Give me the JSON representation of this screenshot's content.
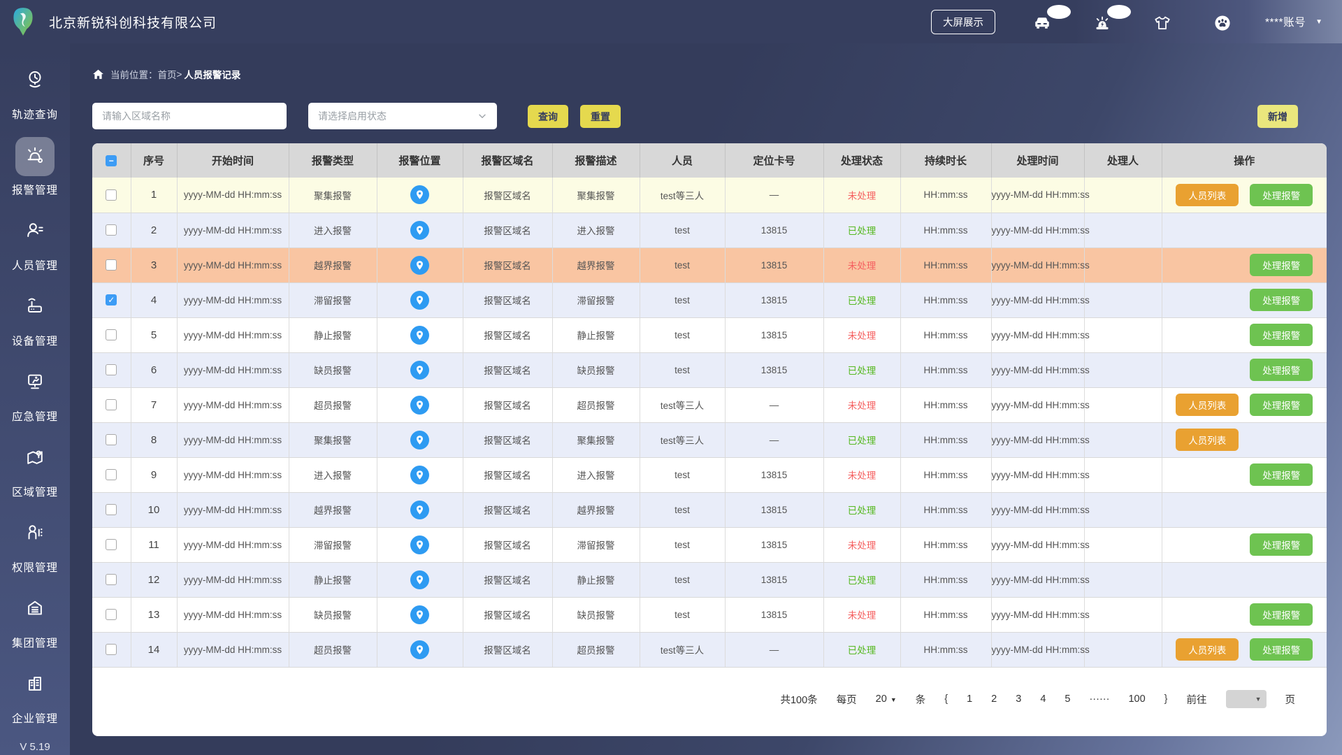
{
  "topbar": {
    "company": "北京新锐科创科技有限公司",
    "big_screen": "大屏展示",
    "account": "****账号",
    "icons": [
      {
        "name": "vehicle-icon",
        "badge": true
      },
      {
        "name": "alarm-light-icon",
        "badge": true
      },
      {
        "name": "tshirt-icon",
        "badge": false
      },
      {
        "name": "paw-icon",
        "badge": false
      }
    ]
  },
  "sidebar": {
    "items": [
      {
        "label": "轨迹查询",
        "icon": "track-icon",
        "active": false
      },
      {
        "label": "报警管理",
        "icon": "siren-icon",
        "active": true
      },
      {
        "label": "人员管理",
        "icon": "person-icon",
        "active": false
      },
      {
        "label": "设备管理",
        "icon": "device-icon",
        "active": false
      },
      {
        "label": "应急管理",
        "icon": "emergency-icon",
        "active": false
      },
      {
        "label": "区域管理",
        "icon": "area-icon",
        "active": false
      },
      {
        "label": "权限管理",
        "icon": "permission-icon",
        "active": false
      },
      {
        "label": "集团管理",
        "icon": "group-icon",
        "active": false
      },
      {
        "label": "企业管理",
        "icon": "enterprise-icon",
        "active": false
      }
    ],
    "version": "V 5.19"
  },
  "breadcrumb": {
    "prefix": "当前位置：",
    "home": "首页",
    "separator": ">",
    "current": "人员报警记录"
  },
  "filters": {
    "area_placeholder": "请输入区域名称",
    "status_placeholder": "请选择启用状态",
    "search": "查询",
    "reset": "重置",
    "add": "新增"
  },
  "table": {
    "columns": [
      "序号",
      "开始时间",
      "报警类型",
      "报警位置",
      "报警区域名",
      "报警描述",
      "人员",
      "定位卡号",
      "处理状态",
      "持续时长",
      "处理时间",
      "处理人",
      "操作"
    ],
    "action_labels": {
      "list": "人员列表",
      "handle": "处理报警"
    },
    "header_checkbox": "indeterminate",
    "rows": [
      {
        "index": "1",
        "start_time": "yyyy-MM-dd HH:mm:ss",
        "type": "聚集报警",
        "area": "报警区域名",
        "desc": "聚集报警",
        "person": "test等三人",
        "card": "—",
        "status": "未处理",
        "status_state": "pending",
        "duration": "HH:mm:ss",
        "handle_time": "yyyy-MM-dd HH:mm:ss",
        "handler": "",
        "checked": false,
        "bg": "highlight-yellow",
        "actions": [
          "list",
          "handle"
        ]
      },
      {
        "index": "2",
        "start_time": "yyyy-MM-dd HH:mm:ss",
        "type": "进入报警",
        "area": "报警区域名",
        "desc": "进入报警",
        "person": "test",
        "card": "13815",
        "status": "已处理",
        "status_state": "done",
        "duration": "HH:mm:ss",
        "handle_time": "yyyy-MM-dd HH:mm:ss",
        "handler": "",
        "checked": false,
        "bg": "stripe",
        "actions": []
      },
      {
        "index": "3",
        "start_time": "yyyy-MM-dd HH:mm:ss",
        "type": "越界报警",
        "area": "报警区域名",
        "desc": "越界报警",
        "person": "test",
        "card": "13815",
        "status": "未处理",
        "status_state": "pending",
        "duration": "HH:mm:ss",
        "handle_time": "yyyy-MM-dd HH:mm:ss",
        "handler": "",
        "checked": false,
        "bg": "highlight-orange",
        "actions": [
          "handle"
        ]
      },
      {
        "index": "4",
        "start_time": "yyyy-MM-dd HH:mm:ss",
        "type": "滞留报警",
        "area": "报警区域名",
        "desc": "滞留报警",
        "person": "test",
        "card": "13815",
        "status": "已处理",
        "status_state": "done",
        "duration": "HH:mm:ss",
        "handle_time": "yyyy-MM-dd HH:mm:ss",
        "handler": "",
        "checked": true,
        "bg": "stripe",
        "actions": [
          "handle"
        ]
      },
      {
        "index": "5",
        "start_time": "yyyy-MM-dd HH:mm:ss",
        "type": "静止报警",
        "area": "报警区域名",
        "desc": "静止报警",
        "person": "test",
        "card": "13815",
        "status": "未处理",
        "status_state": "pending",
        "duration": "HH:mm:ss",
        "handle_time": "yyyy-MM-dd HH:mm:ss",
        "handler": "",
        "checked": false,
        "bg": "plain",
        "actions": [
          "handle"
        ]
      },
      {
        "index": "6",
        "start_time": "yyyy-MM-dd HH:mm:ss",
        "type": "缺员报警",
        "area": "报警区域名",
        "desc": "缺员报警",
        "person": "test",
        "card": "13815",
        "status": "已处理",
        "status_state": "done",
        "duration": "HH:mm:ss",
        "handle_time": "yyyy-MM-dd HH:mm:ss",
        "handler": "",
        "checked": false,
        "bg": "stripe",
        "actions": [
          "handle"
        ]
      },
      {
        "index": "7",
        "start_time": "yyyy-MM-dd HH:mm:ss",
        "type": "超员报警",
        "area": "报警区域名",
        "desc": "超员报警",
        "person": "test等三人",
        "card": "—",
        "status": "未处理",
        "status_state": "pending",
        "duration": "HH:mm:ss",
        "handle_time": "yyyy-MM-dd HH:mm:ss",
        "handler": "",
        "checked": false,
        "bg": "plain",
        "actions": [
          "list",
          "handle"
        ]
      },
      {
        "index": "8",
        "start_time": "yyyy-MM-dd HH:mm:ss",
        "type": "聚集报警",
        "area": "报警区域名",
        "desc": "聚集报警",
        "person": "test等三人",
        "card": "—",
        "status": "已处理",
        "status_state": "done",
        "duration": "HH:mm:ss",
        "handle_time": "yyyy-MM-dd HH:mm:ss",
        "handler": "",
        "checked": false,
        "bg": "stripe",
        "actions": [
          "list"
        ]
      },
      {
        "index": "9",
        "start_time": "yyyy-MM-dd HH:mm:ss",
        "type": "进入报警",
        "area": "报警区域名",
        "desc": "进入报警",
        "person": "test",
        "card": "13815",
        "status": "未处理",
        "status_state": "pending",
        "duration": "HH:mm:ss",
        "handle_time": "yyyy-MM-dd HH:mm:ss",
        "handler": "",
        "checked": false,
        "bg": "plain",
        "actions": [
          "handle"
        ]
      },
      {
        "index": "10",
        "start_time": "yyyy-MM-dd HH:mm:ss",
        "type": "越界报警",
        "area": "报警区域名",
        "desc": "越界报警",
        "person": "test",
        "card": "13815",
        "status": "已处理",
        "status_state": "done",
        "duration": "HH:mm:ss",
        "handle_time": "yyyy-MM-dd HH:mm:ss",
        "handler": "",
        "checked": false,
        "bg": "stripe",
        "actions": []
      },
      {
        "index": "11",
        "start_time": "yyyy-MM-dd HH:mm:ss",
        "type": "滞留报警",
        "area": "报警区域名",
        "desc": "滞留报警",
        "person": "test",
        "card": "13815",
        "status": "未处理",
        "status_state": "pending",
        "duration": "HH:mm:ss",
        "handle_time": "yyyy-MM-dd HH:mm:ss",
        "handler": "",
        "checked": false,
        "bg": "plain",
        "actions": [
          "handle"
        ]
      },
      {
        "index": "12",
        "start_time": "yyyy-MM-dd HH:mm:ss",
        "type": "静止报警",
        "area": "报警区域名",
        "desc": "静止报警",
        "person": "test",
        "card": "13815",
        "status": "已处理",
        "status_state": "done",
        "duration": "HH:mm:ss",
        "handle_time": "yyyy-MM-dd HH:mm:ss",
        "handler": "",
        "checked": false,
        "bg": "stripe",
        "actions": []
      },
      {
        "index": "13",
        "start_time": "yyyy-MM-dd HH:mm:ss",
        "type": "缺员报警",
        "area": "报警区域名",
        "desc": "缺员报警",
        "person": "test",
        "card": "13815",
        "status": "未处理",
        "status_state": "pending",
        "duration": "HH:mm:ss",
        "handle_time": "yyyy-MM-dd HH:mm:ss",
        "handler": "",
        "checked": false,
        "bg": "plain",
        "actions": [
          "handle"
        ]
      },
      {
        "index": "14",
        "start_time": "yyyy-MM-dd HH:mm:ss",
        "type": "超员报警",
        "area": "报警区域名",
        "desc": "超员报警",
        "person": "test等三人",
        "card": "—",
        "status": "已处理",
        "status_state": "done",
        "duration": "HH:mm:ss",
        "handle_time": "yyyy-MM-dd HH:mm:ss",
        "handler": "",
        "checked": false,
        "bg": "stripe",
        "actions": [
          "list",
          "handle"
        ]
      }
    ]
  },
  "pagination": {
    "total": "共100条",
    "per_page_label": "每页",
    "per_page_value": "20",
    "per_page_unit": "条",
    "prev": "{",
    "next": "}",
    "pages": [
      "1",
      "2",
      "3",
      "4",
      "5",
      "······",
      "100"
    ],
    "goto_label": "前往",
    "goto_unit": "页"
  },
  "colors": {
    "accent_yellow": "#e5d94e",
    "status_pending": "#f55f5f",
    "status_done": "#55b81f",
    "action_list_btn": "#e9a131",
    "action_handle_btn": "#6ec351",
    "location_icon_blue": "#2e9bf2",
    "row_stripe": "#e9edf9",
    "row_highlight_yellow": "#fcfce4",
    "row_highlight_orange": "#f9c5a2",
    "navy": "#363e5e"
  }
}
